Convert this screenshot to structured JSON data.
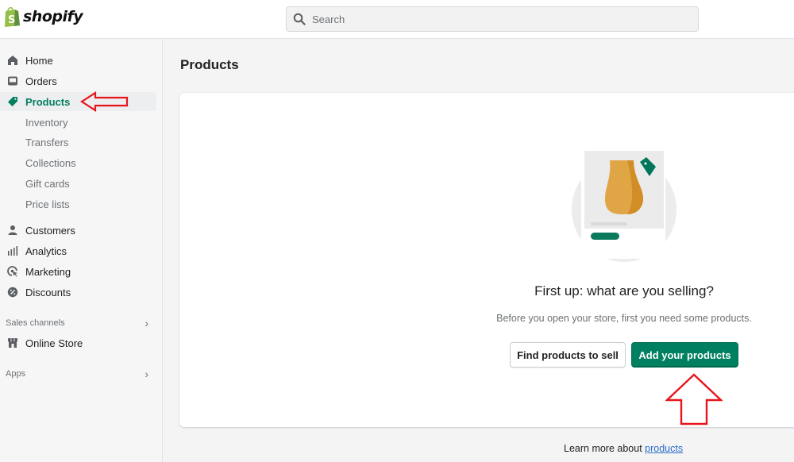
{
  "app": {
    "brand": "shopify",
    "brand_color": "#95bf47",
    "accent_color": "#008060"
  },
  "search": {
    "placeholder": "Search",
    "icon": "search-icon"
  },
  "sidebar": {
    "main_items": [
      {
        "label": "Home",
        "icon": "home-icon"
      },
      {
        "label": "Orders",
        "icon": "orders-inbox-icon"
      },
      {
        "label": "Products",
        "icon": "tag-icon",
        "active": true
      }
    ],
    "product_subitems": [
      "Inventory",
      "Transfers",
      "Collections",
      "Gift cards",
      "Price lists"
    ],
    "more_items": [
      {
        "label": "Customers",
        "icon": "customer-icon"
      },
      {
        "label": "Analytics",
        "icon": "analytics-bars-icon"
      },
      {
        "label": "Marketing",
        "icon": "marketing-target-icon"
      },
      {
        "label": "Discounts",
        "icon": "discount-icon"
      }
    ],
    "sales_channels": {
      "label": "Sales channels",
      "chevron": "chevron-right-icon",
      "items": [
        {
          "label": "Online Store",
          "icon": "store-icon"
        }
      ]
    },
    "apps": {
      "label": "Apps",
      "chevron": "chevron-right-icon"
    }
  },
  "main": {
    "page_title": "Products",
    "empty_state": {
      "illustration": "product-vase-with-tag-illustration",
      "title": "First up: what are you selling?",
      "description": "Before you open your store, first you need some products.",
      "secondary_action": "Find products to sell",
      "primary_action": "Add your products"
    },
    "footer": {
      "prefix": "Learn more about ",
      "link": "products"
    }
  },
  "annotations": {
    "color": "#e8141c",
    "arrows": [
      "arrow pointing to Products nav item",
      "arrow pointing to Add your products button"
    ]
  }
}
